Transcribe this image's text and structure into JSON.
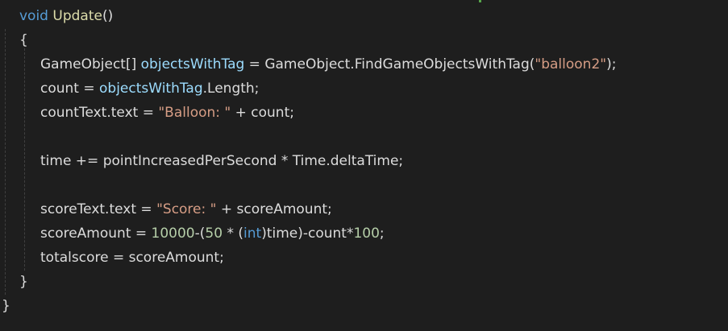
{
  "code": {
    "l1": {
      "kw": "void",
      "name": "Update",
      "rest": "()"
    },
    "l2": "{",
    "l3": {
      "a": "GameObject[] ",
      "var": "objectsWithTag",
      "b": " = GameObject.FindGameObjectsWithTag(",
      "str": "\"balloon2\"",
      "c": ");"
    },
    "l4": {
      "a": "count = ",
      "var": "objectsWithTag",
      "b": ".Length;"
    },
    "l5": {
      "a": "countText.text = ",
      "str": "\"Balloon: \"",
      "b": " + count;"
    },
    "l6": "time += pointIncreasedPerSecond * Time.deltaTime;",
    "l7": {
      "a": "scoreText.text = ",
      "str": "\"Score: \"",
      "b": " + scoreAmount;"
    },
    "l8": {
      "a": "scoreAmount = ",
      "n1": "10000",
      "b": "-(",
      "n2": "50",
      "c": " * (",
      "kw": "int",
      "d": ")time)-count*",
      "n3": "100",
      "e": ";"
    },
    "l9": "totalscore = scoreAmount;",
    "l10": "}",
    "l11": "}"
  },
  "colors": {
    "background": "#1e1e1e",
    "keyword": "#569cd6",
    "string": "#d69d85",
    "number": "#b5cea8",
    "local": "#9cdcfe",
    "method": "#dcdcaa",
    "text": "#dcdcdc"
  }
}
